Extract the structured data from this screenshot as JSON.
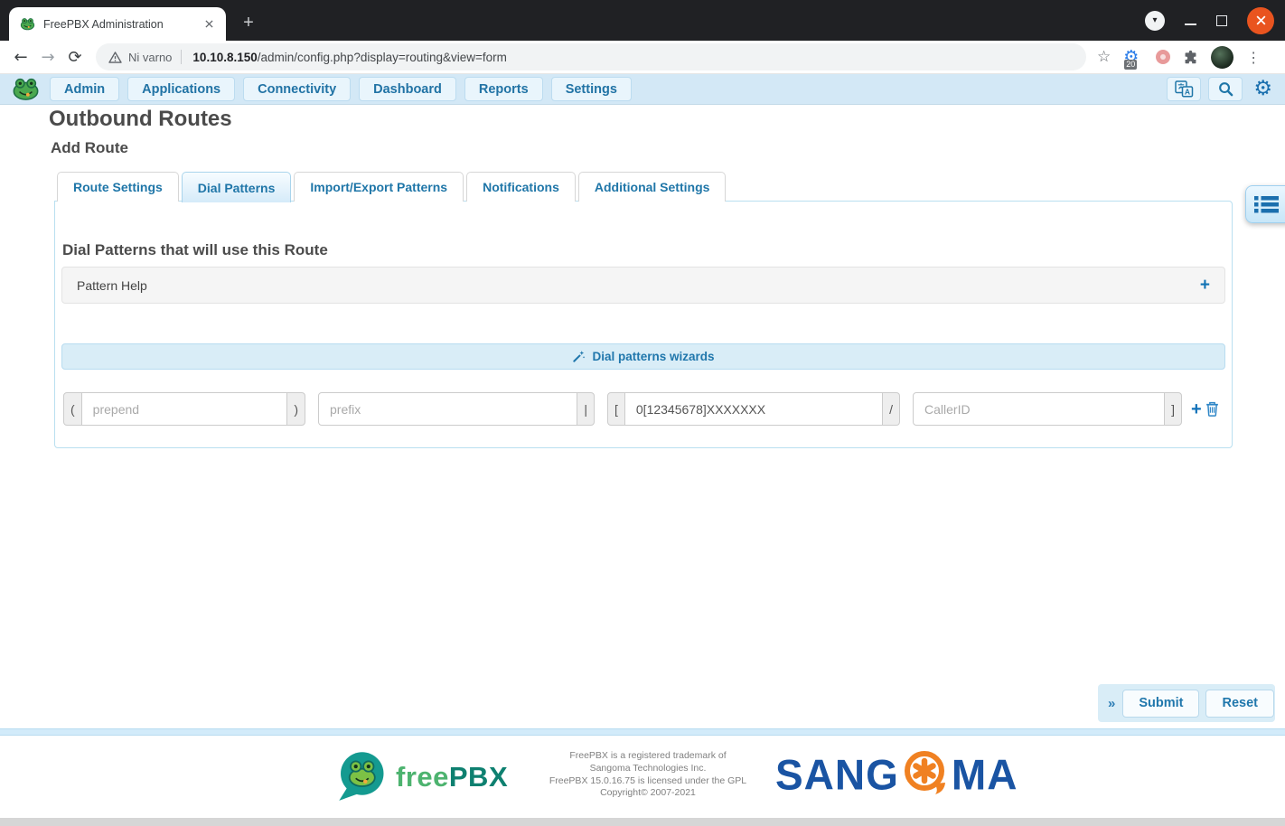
{
  "browser": {
    "tab_title": "FreePBX Administration",
    "security_label": "Ni varno",
    "url_host": "10.10.8.150",
    "url_path": "/admin/config.php?display=routing&view=form",
    "extension_badge": "20"
  },
  "icons": {
    "back": "←",
    "forward": "→",
    "reload": "⟳",
    "star": "☆",
    "gear_extension": "⚙",
    "kebab": "⋮",
    "new_tab": "+",
    "settings_gear": "⚙",
    "expand_plus": "+",
    "add_row": "+",
    "collapse_chevrons": "»",
    "tab_search_caret": "▾"
  },
  "navbar": {
    "items": [
      "Admin",
      "Applications",
      "Connectivity",
      "Dashboard",
      "Reports",
      "Settings"
    ]
  },
  "page": {
    "title": "Outbound Routes",
    "subtitle": "Add Route"
  },
  "tabs": [
    "Route Settings",
    "Dial Patterns",
    "Import/Export Patterns",
    "Notifications",
    "Additional Settings"
  ],
  "panel": {
    "heading": "Dial Patterns that will use this Route",
    "pattern_help": "Pattern Help",
    "wizards_button": "Dial patterns wizards"
  },
  "pattern_row": {
    "open_paren": "(",
    "prepend_placeholder": "prepend",
    "close_paren": ")",
    "prefix_placeholder": "prefix",
    "pipe": "|",
    "open_bracket": "[",
    "match_value": "0[12345678]XXXXXXX",
    "slash": "/",
    "callerid_placeholder": "CallerID",
    "close_bracket": "]"
  },
  "actions": {
    "submit": "Submit",
    "reset": "Reset"
  },
  "footer": {
    "brand_free": "free",
    "brand_pbx": "PBX",
    "lines": [
      "FreePBX is a registered trademark of",
      "Sangoma Technologies Inc.",
      "FreePBX 15.0.16.75 is licensed under the GPL",
      "Copyright© 2007-2021"
    ],
    "sangoma_prefix": "SANG",
    "sangoma_suffix": "MA"
  },
  "colors": {
    "accent_blue": "#2173a5",
    "navbar_bg": "#d3e8f6",
    "panel_border": "#b9dff0",
    "wizards_bg": "#d9edf7",
    "close_button": "#e9541f",
    "sangoma_blue": "#1a54a3",
    "sangoma_orange": "#f08122",
    "freepbx_teal": "#149a90",
    "freepbx_green": "#4db36f"
  }
}
